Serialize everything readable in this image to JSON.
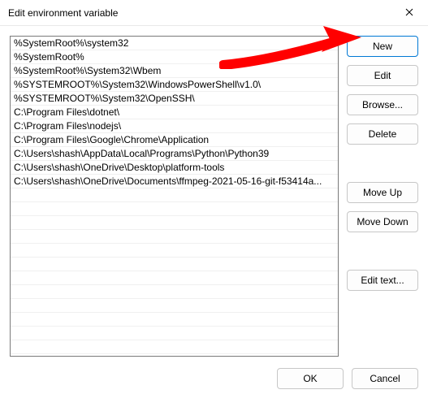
{
  "window": {
    "title": "Edit environment variable"
  },
  "list": {
    "items": [
      "%SystemRoot%\\system32",
      "%SystemRoot%",
      "%SystemRoot%\\System32\\Wbem",
      "%SYSTEMROOT%\\System32\\WindowsPowerShell\\v1.0\\",
      "%SYSTEMROOT%\\System32\\OpenSSH\\",
      "C:\\Program Files\\dotnet\\",
      "C:\\Program Files\\nodejs\\",
      "C:\\Program Files\\Google\\Chrome\\Application",
      "C:\\Users\\shash\\AppData\\Local\\Programs\\Python\\Python39",
      "C:\\Users\\shash\\OneDrive\\Desktop\\platform-tools",
      "C:\\Users\\shash\\OneDrive\\Documents\\ffmpeg-2021-05-16-git-f53414a..."
    ]
  },
  "buttons": {
    "new": "New",
    "edit": "Edit",
    "browse": "Browse...",
    "delete": "Delete",
    "moveUp": "Move Up",
    "moveDown": "Move Down",
    "editText": "Edit text...",
    "ok": "OK",
    "cancel": "Cancel"
  },
  "annotation": {
    "arrow_color": "#ff0000",
    "arrow_points_to": "new-button"
  }
}
